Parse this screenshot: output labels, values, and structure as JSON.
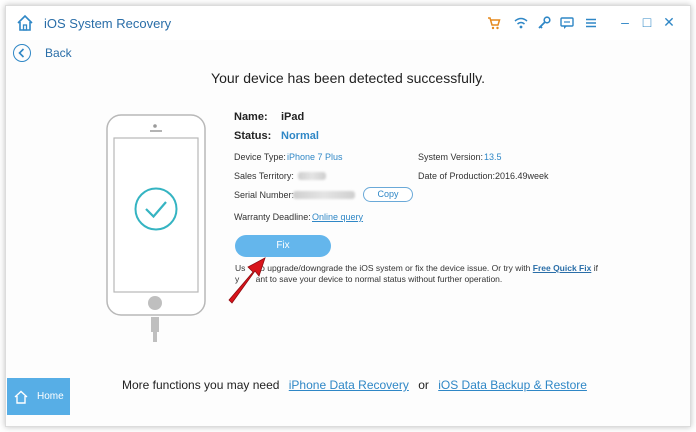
{
  "window": {
    "title": "iOS System Recovery"
  },
  "nav": {
    "back_label": "Back"
  },
  "headline": "Your device has been detected successfully.",
  "device": {
    "name_label": "Name:",
    "name_value": "iPad",
    "status_label": "Status:",
    "status_value": "Normal",
    "type_label": "Device Type:",
    "type_value": "iPhone 7 Plus",
    "system_label": "System Version:",
    "system_value": "13.5",
    "territory_label": "Sales Territory:",
    "production_label": "Date of Production:",
    "production_value": "2016.49week",
    "serial_label": "Serial Number:",
    "copy_label": "Copy",
    "warranty_label": "Warranty Deadline:",
    "warranty_link": "Online query"
  },
  "fix_button": "Fix",
  "note": {
    "line1_a": "Us",
    "line1_b": "to upgrade/downgrade the iOS system or fix the device issue. Or try with",
    "line1_link": "Free Quick Fix",
    "line1_c": "if",
    "line2_a": "y",
    "line2_b": "ant to save your device to normal status without further operation."
  },
  "footer": {
    "home_label": "Home",
    "more_text": "More functions you may need",
    "link1": "iPhone Data Recovery",
    "or_text": "or",
    "link2": "iOS Data Backup & Restore"
  },
  "icons": {
    "title_home": "home-icon",
    "cart": "cart-icon",
    "wifi": "wifi-icon",
    "key": "key-icon",
    "chat": "chat-icon",
    "menu": "menu-icon",
    "minimize": "minimize-icon",
    "maximize": "maximize-icon",
    "close": "close-icon",
    "back": "back-arrow-icon",
    "check": "check-circle-icon",
    "arrow": "red-arrow-icon",
    "home_tab": "home-icon"
  },
  "colors": {
    "accent": "#2f87c6",
    "fix_button": "#64b6ec",
    "home_tab": "#57aee6",
    "arrow": "#d9141b",
    "check": "#35b4c2"
  }
}
